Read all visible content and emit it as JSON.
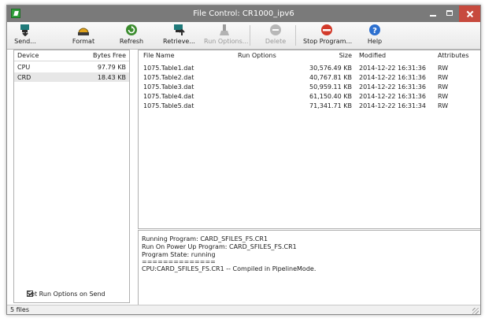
{
  "window": {
    "title": "File Control: CR1000_ipv6"
  },
  "toolbar": {
    "send": "Send...",
    "format": "Format",
    "refresh": "Refresh",
    "retrieve": "Retrieve...",
    "run_options": "Run Options...",
    "delete": "Delete",
    "stop_program": "Stop Program...",
    "help": "Help"
  },
  "devices": {
    "headers": {
      "device": "Device",
      "bytes_free": "Bytes Free"
    },
    "rows": [
      {
        "device": "CPU",
        "bytes_free": "97.79 KB"
      },
      {
        "device": "CRD",
        "bytes_free": "18.43 KB"
      }
    ],
    "set_run_options": "Set Run Options on Send"
  },
  "files": {
    "headers": {
      "name": "File Name",
      "run_options": "Run Options",
      "size": "Size",
      "modified": "Modified",
      "attributes": "Attributes"
    },
    "rows": [
      {
        "name": "1075.Table1.dat",
        "size": "30,576.49  KB",
        "modified": "2014-12-22 16:31:36",
        "attributes": "RW"
      },
      {
        "name": "1075.Table2.dat",
        "size": "40,767.81  KB",
        "modified": "2014-12-22 16:31:36",
        "attributes": "RW"
      },
      {
        "name": "1075.Table3.dat",
        "size": "50,959.11  KB",
        "modified": "2014-12-22 16:31:36",
        "attributes": "RW"
      },
      {
        "name": "1075.Table4.dat",
        "size": "61,150.40  KB",
        "modified": "2014-12-22 16:31:36",
        "attributes": "RW"
      },
      {
        "name": "1075.Table5.dat",
        "size": "71,341.71  KB",
        "modified": "2014-12-22 16:31:34",
        "attributes": "RW"
      }
    ]
  },
  "log": {
    "lines": [
      "Running Program: CARD_SFILES_FS.CR1",
      "Run On Power Up Program: CARD_SFILES_FS.CR1",
      "Program State: running",
      "==============",
      "CPU:CARD_SFILES_FS.CR1 -- Compiled in PipelineMode."
    ]
  },
  "status": {
    "text": "5 files"
  },
  "colors": {
    "titlebar": "#7a7a7a",
    "close": "#c74a3e",
    "selected_row": "#e7e7e7"
  },
  "icons": [
    "send-icon",
    "format-icon",
    "refresh-icon",
    "retrieve-icon",
    "run-options-icon",
    "delete-icon",
    "stop-program-icon",
    "help-icon"
  ]
}
